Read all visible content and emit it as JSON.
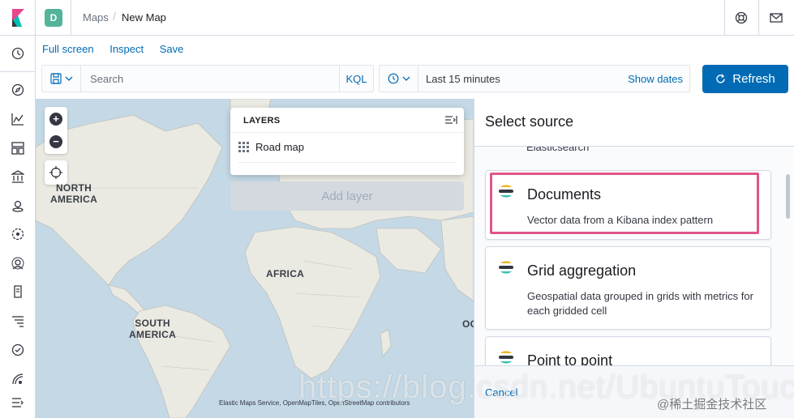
{
  "header": {
    "space_initial": "D",
    "breadcrumbs": [
      "Maps",
      "New Map"
    ],
    "icons": [
      "elastic-logo-icon",
      "help-icon",
      "mail-icon"
    ]
  },
  "sidenav": {
    "icons": [
      "clock-icon",
      "compass-icon",
      "visualize-icon",
      "dashboard-icon",
      "canvas-icon",
      "maps-icon",
      "ml-icon",
      "user-icon",
      "logs-icon",
      "apm-icon",
      "uptime-icon",
      "signal-icon",
      "menu-collapse-icon"
    ]
  },
  "topmenu": {
    "items": [
      "Full screen",
      "Inspect",
      "Save"
    ]
  },
  "querybar": {
    "placeholder": "Search",
    "language": "KQL"
  },
  "datepicker": {
    "range": "Last 15 minutes",
    "show_dates": "Show dates"
  },
  "refresh": {
    "label": "Refresh"
  },
  "map": {
    "labels": {
      "north_america": "NORTH\nAMERICA",
      "south_america": "SOUTH\nAMERICA",
      "africa": "AFRICA",
      "partial": "OC"
    },
    "attribution": "Elastic Maps Service, OpenMapTiles, OpenStreetMap contributors",
    "layers_panel": {
      "title": "LAYERS",
      "layers": [
        "Road map"
      ]
    },
    "add_layer_label": "Add layer"
  },
  "flyout": {
    "title": "Select source",
    "partial_top_text": "Elasticsearch",
    "sources": [
      {
        "title": "Documents",
        "description": "Vector data from a Kibana index pattern"
      },
      {
        "title": "Grid aggregation",
        "description": "Geospatial data grouped in grids with metrics for each gridded cell"
      },
      {
        "title": "Point to point",
        "description": ""
      }
    ],
    "cancel_label": "Cancel"
  },
  "watermark": {
    "url": "https://blog.csdn.net/UbuntuTouch",
    "site": "@稀土掘金技术社区"
  },
  "colors": {
    "primary": "#006bb4",
    "highlight": "#e0558a",
    "space_badge": "#54b399",
    "map_water": "#c4d8e5",
    "map_land": "#eae9e2"
  }
}
